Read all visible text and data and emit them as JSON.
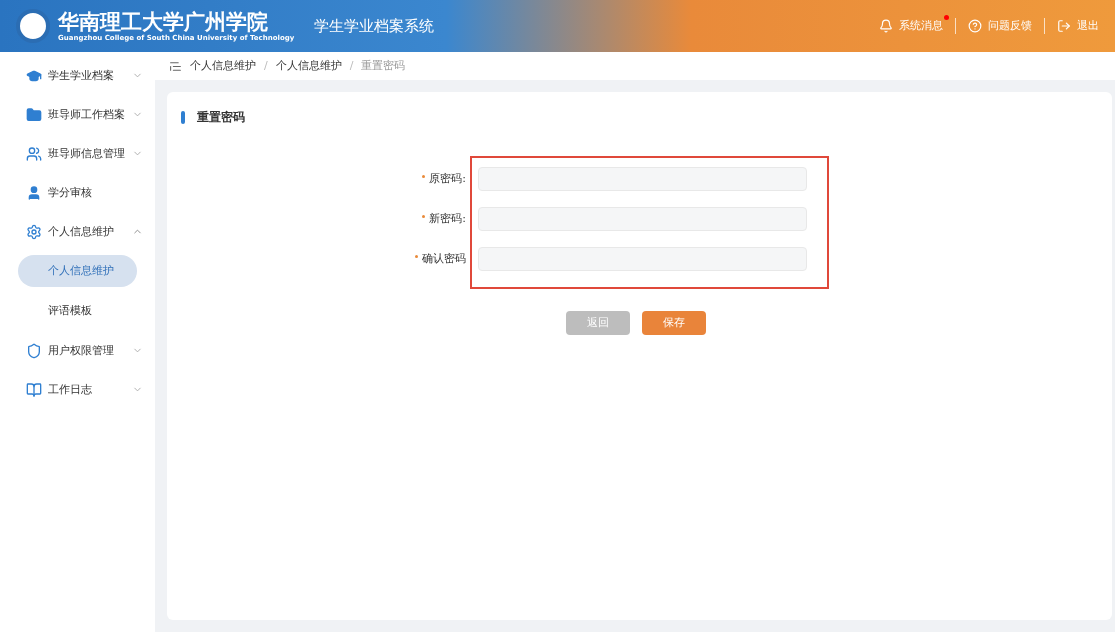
{
  "header": {
    "logo_text": "华南理工大学广州学院",
    "logo_subtitle": "Guangzhou College of South China University of Technology",
    "system_title": "学生学业档案系统",
    "actions": [
      {
        "kind": "bell",
        "label": "系统消息",
        "unread": true
      },
      {
        "kind": "help",
        "label": "问题反馈",
        "unread": false
      },
      {
        "kind": "logout",
        "label": "退出",
        "unread": false
      }
    ]
  },
  "sidebar": {
    "items": [
      {
        "kind": "cap",
        "label": "学生学业档案",
        "expandable": true,
        "expanded": false
      },
      {
        "kind": "folder",
        "label": "班导师工作档案",
        "expandable": true,
        "expanded": false
      },
      {
        "kind": "people",
        "label": "班导师信息管理",
        "expandable": true,
        "expanded": false
      },
      {
        "kind": "person",
        "label": "学分审核",
        "expandable": false
      },
      {
        "kind": "gear",
        "label": "个人信息维护",
        "expandable": true,
        "expanded": true,
        "children": [
          {
            "label": "个人信息维护",
            "selected": true
          },
          {
            "label": "评语模板",
            "selected": false
          }
        ]
      },
      {
        "kind": "shield",
        "label": "用户权限管理",
        "expandable": true,
        "expanded": false
      },
      {
        "kind": "book",
        "label": "工作日志",
        "expandable": true,
        "expanded": false
      }
    ]
  },
  "breadcrumb": [
    "个人信息维护",
    "个人信息维护",
    "重置密码"
  ],
  "breadcrumb_separator": "/",
  "card": {
    "title": "重置密码",
    "fields": [
      {
        "label": "原密码:",
        "required": true
      },
      {
        "label": "新密码:",
        "required": true
      },
      {
        "label": "确认密码",
        "required": true
      }
    ],
    "buttons": [
      {
        "kind": "secondary",
        "label": "返回"
      },
      {
        "kind": "primary",
        "label": "保存"
      }
    ]
  }
}
